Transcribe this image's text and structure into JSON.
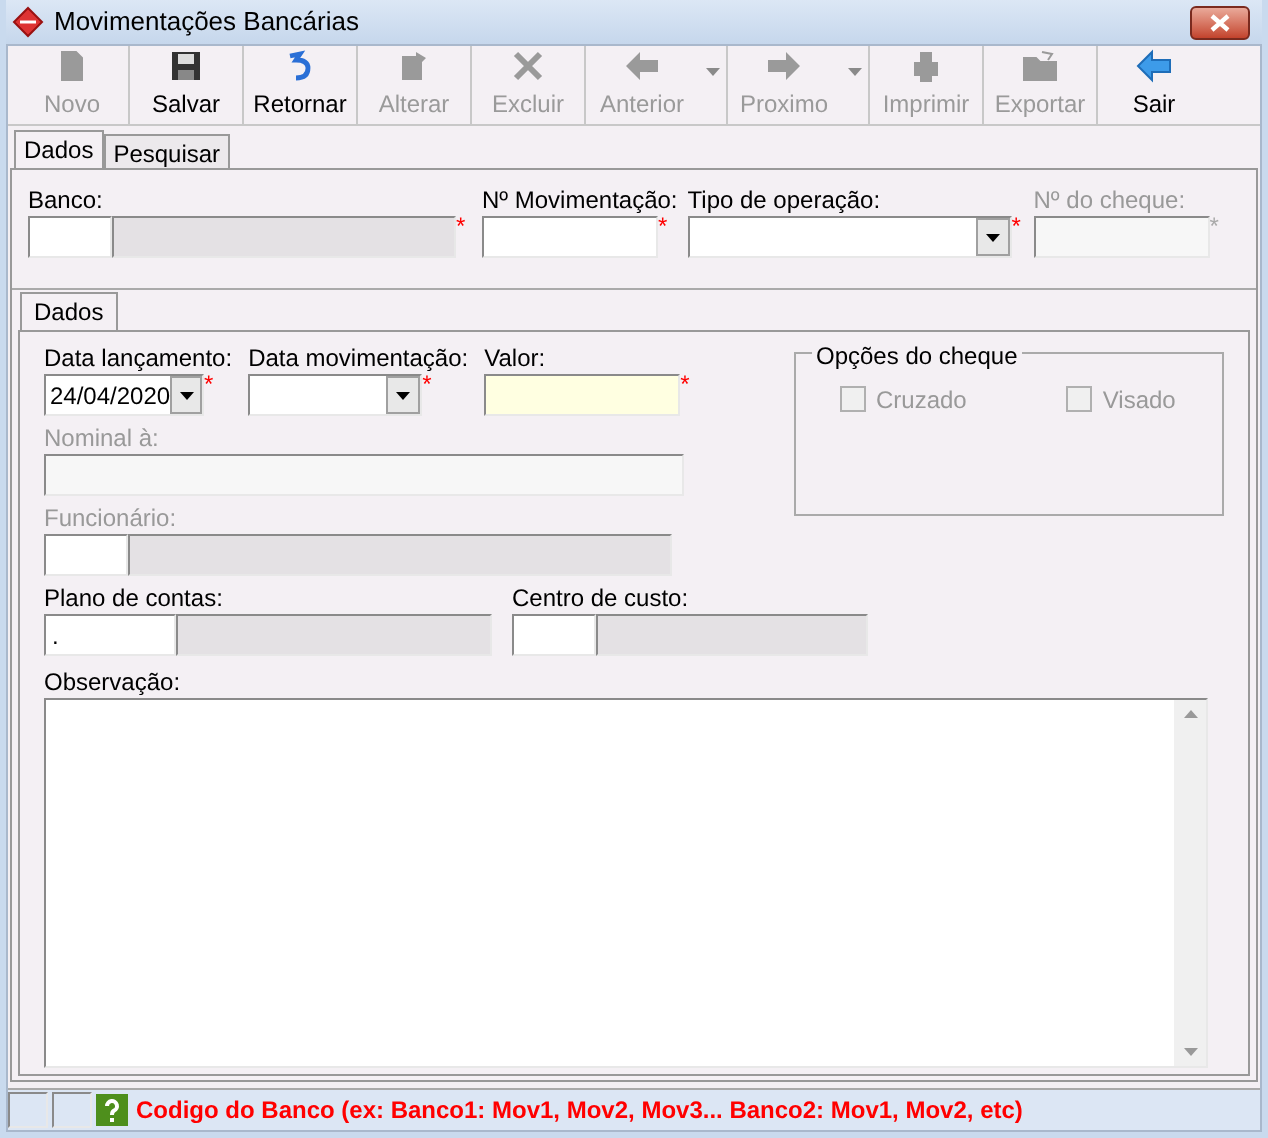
{
  "window": {
    "title": "Movimentações Bancárias"
  },
  "toolbar": [
    {
      "label": "Novo",
      "disabled": true,
      "dropdown": false
    },
    {
      "label": "Salvar",
      "disabled": false,
      "dropdown": false
    },
    {
      "label": "Retornar",
      "disabled": false,
      "dropdown": false
    },
    {
      "label": "Alterar",
      "disabled": true,
      "dropdown": false
    },
    {
      "label": "Excluir",
      "disabled": true,
      "dropdown": false
    },
    {
      "label": "Anterior",
      "disabled": true,
      "dropdown": true
    },
    {
      "label": "Proximo",
      "disabled": true,
      "dropdown": true
    },
    {
      "label": "Imprimir",
      "disabled": true,
      "dropdown": false
    },
    {
      "label": "Exportar",
      "disabled": true,
      "dropdown": false
    },
    {
      "label": "Sair",
      "disabled": false,
      "dropdown": false
    }
  ],
  "tabs": [
    {
      "label": "Dados",
      "selected": true
    },
    {
      "label": "Pesquisar",
      "selected": false
    }
  ],
  "header_fields": [
    {
      "kind": "lookup",
      "label": "Banco:",
      "required_mark": "*",
      "disabled": false
    },
    {
      "kind": "text",
      "label": "Nº Movimentação:",
      "required_mark": "*",
      "disabled": false
    },
    {
      "kind": "select",
      "label": "Tipo de operação:",
      "required_mark": "*",
      "disabled": false
    },
    {
      "kind": "text",
      "label": "Nº do cheque:",
      "required_mark": "*",
      "disabled": true
    }
  ],
  "inner_tabs": [
    {
      "label": "Dados",
      "selected": true
    }
  ],
  "form_rows": [
    [
      {
        "kind": "date",
        "label": "Data lançamento:",
        "value": "24/04/2020",
        "required_mark": "*",
        "disabled": false
      },
      {
        "kind": "date",
        "label": "Data movimentação:",
        "required_mark": "*",
        "disabled": false
      },
      {
        "kind": "money",
        "label": "Valor:",
        "required_mark": "*",
        "disabled": false
      }
    ],
    [
      {
        "kind": "text",
        "label": "Nominal à:",
        "disabled": true
      }
    ],
    [
      {
        "kind": "lookup",
        "label": "Funcionário:",
        "disabled": true
      }
    ],
    [
      {
        "kind": "lookup",
        "label": "Plano de contas:",
        "value": ".",
        "disabled": false
      },
      {
        "kind": "lookup",
        "label": "Centro de custo:",
        "disabled": false
      }
    ]
  ],
  "cheque_options": {
    "title": "Opções do cheque",
    "options": [
      {
        "label": "Cruzado",
        "checked": false,
        "disabled": true
      },
      {
        "label": "Visado",
        "checked": false,
        "disabled": true
      }
    ]
  },
  "notes": {
    "label": "Observação:"
  },
  "status_bar": {
    "message": "Codigo do Banco (ex: Banco1: Mov1, Mov2, Mov3... Banco2: Mov1, Mov2, etc)"
  }
}
